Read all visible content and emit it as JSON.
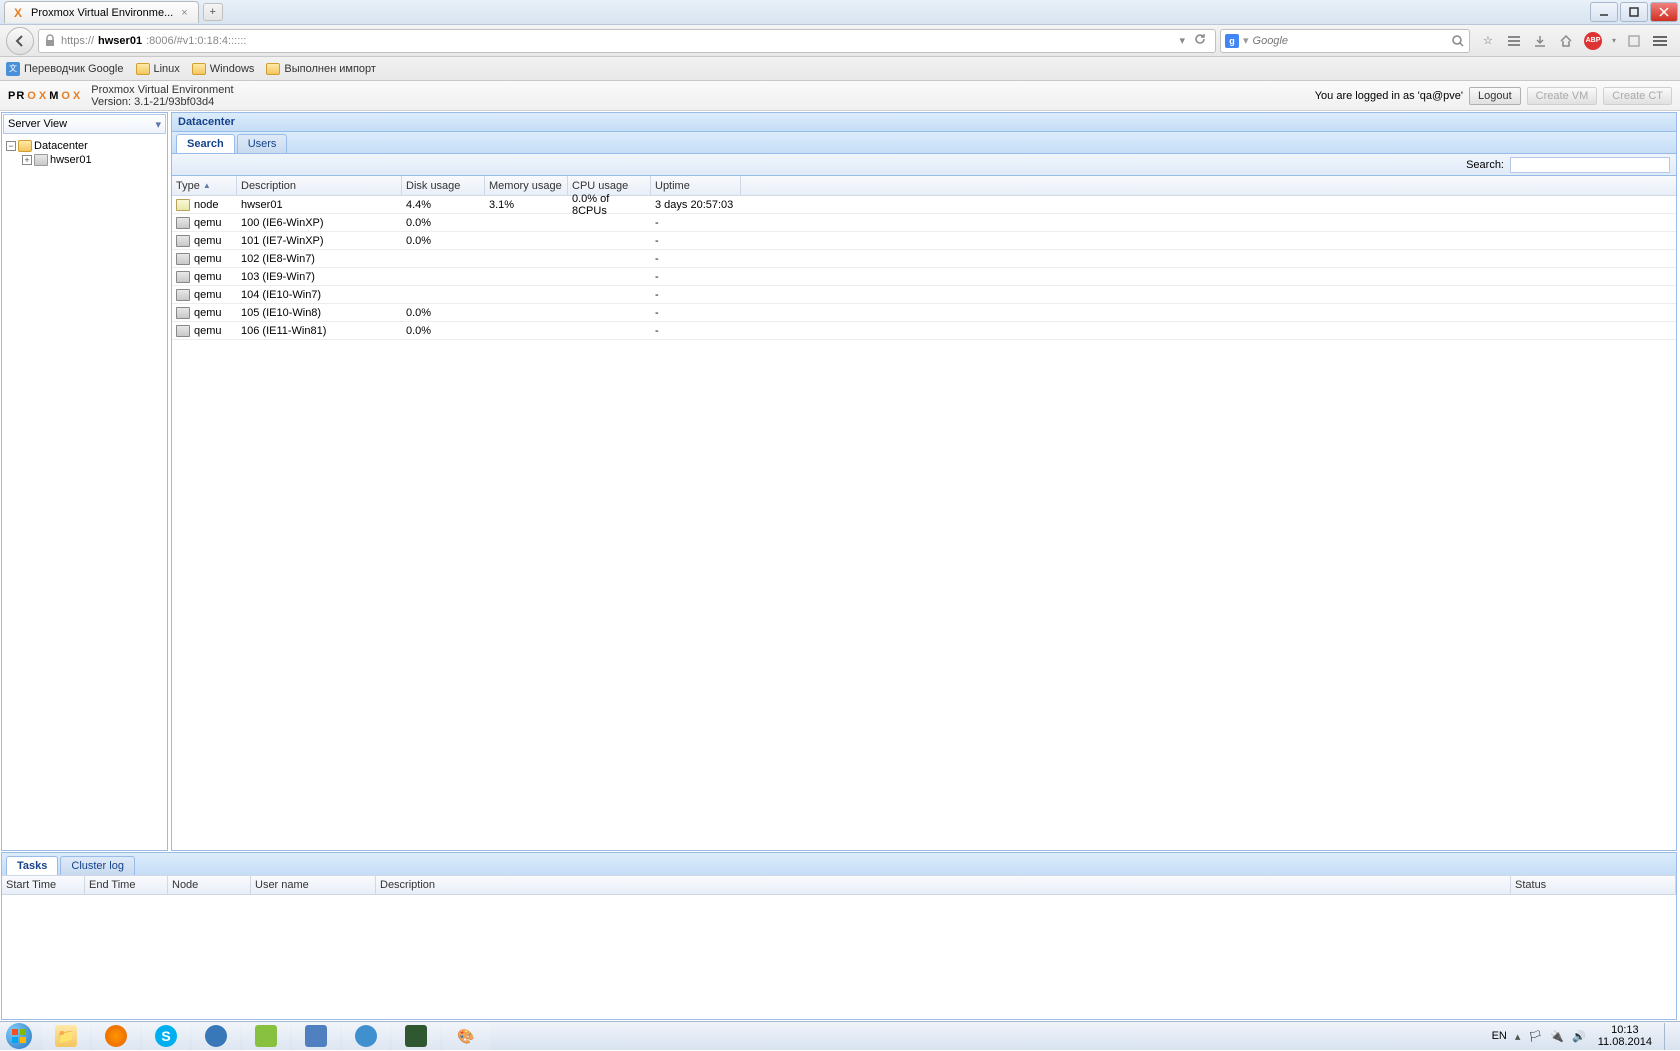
{
  "window": {
    "tab_title": "Proxmox Virtual Environme...",
    "url_host": "hwser01",
    "url_rest": ":8006/#v1:0:18:4::::::",
    "url_scheme": "https://",
    "search_placeholder": "Google"
  },
  "bookmarks": [
    {
      "label": "Переводчик Google",
      "ico": "trans"
    },
    {
      "label": "Linux",
      "ico": "folder"
    },
    {
      "label": "Windows",
      "ico": "folder"
    },
    {
      "label": "Выполнен импорт",
      "ico": "folder"
    }
  ],
  "proxmox": {
    "title": "Proxmox Virtual Environment",
    "version": "Version: 3.1-21/93bf03d4",
    "login_text": "You are logged in as 'qa@pve'",
    "logout": "Logout",
    "create_vm": "Create VM",
    "create_ct": "Create CT"
  },
  "sidebar": {
    "view_label": "Server View",
    "tree": {
      "root": "Datacenter",
      "nodes": [
        "hwser01"
      ]
    }
  },
  "breadcrumb": "Datacenter",
  "tabs": [
    {
      "label": "Search",
      "active": true
    },
    {
      "label": "Users",
      "active": false
    }
  ],
  "search_label": "Search:",
  "grid_columns": [
    "Type",
    "Description",
    "Disk usage",
    "Memory usage",
    "CPU usage",
    "Uptime"
  ],
  "rows": [
    {
      "type": "node",
      "desc": "hwser01",
      "disk": "4.4%",
      "mem": "3.1%",
      "cpu": "0.0% of 8CPUs",
      "up": "3 days 20:57:03"
    },
    {
      "type": "qemu",
      "desc": "100 (IE6-WinXP)",
      "disk": "0.0%",
      "mem": "",
      "cpu": "",
      "up": "-"
    },
    {
      "type": "qemu",
      "desc": "101 (IE7-WinXP)",
      "disk": "0.0%",
      "mem": "",
      "cpu": "",
      "up": "-"
    },
    {
      "type": "qemu",
      "desc": "102 (IE8-Win7)",
      "disk": "",
      "mem": "",
      "cpu": "",
      "up": "-"
    },
    {
      "type": "qemu",
      "desc": "103 (IE9-Win7)",
      "disk": "",
      "mem": "",
      "cpu": "",
      "up": "-"
    },
    {
      "type": "qemu",
      "desc": "104 (IE10-Win7)",
      "disk": "",
      "mem": "",
      "cpu": "",
      "up": "-"
    },
    {
      "type": "qemu",
      "desc": "105 (IE10-Win8)",
      "disk": "0.0%",
      "mem": "",
      "cpu": "",
      "up": "-"
    },
    {
      "type": "qemu",
      "desc": "106 (IE11-Win81)",
      "disk": "0.0%",
      "mem": "",
      "cpu": "",
      "up": "-"
    }
  ],
  "bottom_tabs": [
    {
      "label": "Tasks",
      "active": true
    },
    {
      "label": "Cluster log",
      "active": false
    }
  ],
  "bottom_columns": [
    "Start Time",
    "End Time",
    "Node",
    "User name",
    "Description",
    "Status"
  ],
  "tray": {
    "lang": "EN",
    "time": "10:13",
    "date": "11.08.2014"
  }
}
